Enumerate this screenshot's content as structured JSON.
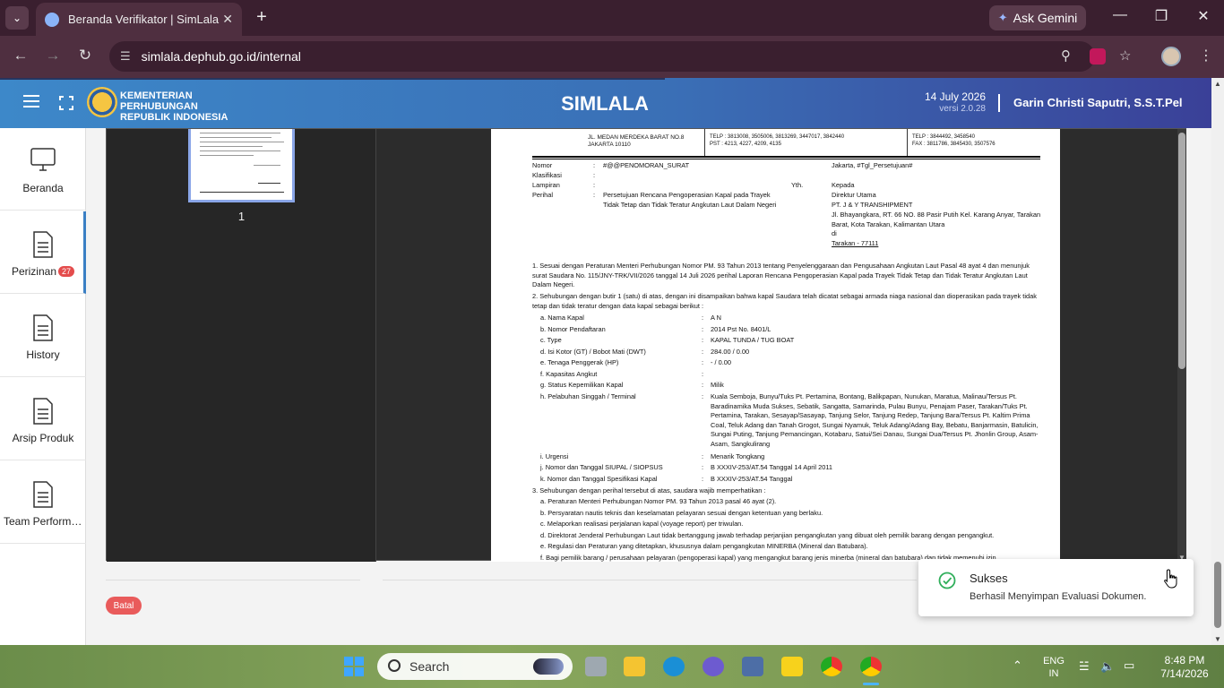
{
  "browser": {
    "tab_title": "Beranda Verifikator | SimLala",
    "url": "simlala.dephub.go.id/internal",
    "gemini_label": "Ask Gemini"
  },
  "header": {
    "ministry_line1": "KEMENTERIAN PERHUBUNGAN",
    "ministry_line2": "REPUBLIK INDONESIA",
    "app_title": "SIMLALA",
    "date": "14 July 2026",
    "version": "versi 2.0.28",
    "user": "Garin Christi Saputri, S.S.T.Pel"
  },
  "sidebar": {
    "items": [
      {
        "label": "Beranda",
        "icon": "monitor-icon"
      },
      {
        "label": "Perizinan",
        "icon": "document-icon",
        "badge": "27"
      },
      {
        "label": "History",
        "icon": "document-icon"
      },
      {
        "label": "Arsip Produk",
        "icon": "document-icon"
      },
      {
        "label": "Team Performance",
        "icon": "document-icon"
      }
    ]
  },
  "viewer": {
    "page_number": "1"
  },
  "letter": {
    "address_line1": "JL. MEDAN MERDEKA BARAT NO.8",
    "address_line2": "JAKARTA 10110",
    "telp1": "TELP :  3813008, 3505006, 3813269, 3447017, 3842440",
    "pst": "PST   :  4213, 4227, 4209, 4135",
    "telp2": "TELP :  3844492, 3458540",
    "fax": "FAX  :  3811786, 3845430, 3507576",
    "nomor_label": "Nomor",
    "nomor_value": "#@@PENOMORAN_SURAT",
    "klasifikasi_label": "Klasifikasi",
    "lampiran_label": "Lampiran",
    "perihal_label": "Perihal",
    "perihal_value": "Persetujuan Rencana Pengoperasian Kapal pada Trayek Tidak Tetap dan Tidak Teratur Angkutan Laut Dalam Negeri",
    "place_date": "Jakarta, #Tgl_Persetujuan#",
    "yth": "Yth.",
    "kepada": "Kepada",
    "recipient1": "Direktur Utama",
    "recipient2": "PT. J & Y TRANSHIPMENT",
    "recipient_addr": "Jl. Bhayangkara, RT. 66 NO. 88 Pasir Putih Kel. Karang Anyar, Tarakan Barat, Kota Tarakan, Kalimantan Utara",
    "di": "di",
    "city": "Tarakan  - 77111",
    "para1": "1. Sesuai dengan Peraturan Menteri Perhubungan Nomor PM. 93 Tahun 2013 tentang Penyelenggaraan dan Pengusahaan Angkutan Laut Pasal 48 ayat 4 dan menunjuk surat Saudara No. 115/JNY-TRK/VII/2026 tanggal 14 Juli 2026 perihal Laporan Rencana Pengoperasian Kapal pada Trayek Tidak Tetap dan Tidak Teratur Angkutan Laut Dalam Negeri.",
    "para2": "2. Sehubungan dengan butir 1 (satu) di atas, dengan ini disampaikan bahwa kapal Saudara telah dicatat sebagai armada niaga nasional dan dioperasikan pada trayek tidak tetap dan tidak teratur dengan data kapal sebagai berikut :",
    "ship_rows": [
      {
        "label": "a. Nama Kapal",
        "value": "A N"
      },
      {
        "label": "b. Nomor Pendaftaran",
        "value": "2014 Pst No. 8401/L"
      },
      {
        "label": "c. Type",
        "value": "KAPAL TUNDA / TUG BOAT"
      },
      {
        "label": "d. Isi Kotor (GT) / Bobot Mati (DWT)",
        "value": "284.00  / 0.00"
      },
      {
        "label": "e. Tenaga Penggerak (HP)",
        "value": "-  / 0.00"
      },
      {
        "label": "f.  Kapasitas Angkut",
        "value": ""
      },
      {
        "label": "g. Status Kepemilikan Kapal",
        "value": "Milik"
      },
      {
        "label": "h. Pelabuhan Singgah / Terminal",
        "value": "Kuala Semboja, Bunyu/Tuks Pt. Pertamina, Bontang, Balikpapan, Nunukan, Maratua, Malinau/Tersus Pt. Baradinamika Muda Sukses, Sebatik, Sangatta, Samarinda, Pulau Bunyu, Penajam Paser, Tarakan/Tuks Pt. Pertamina, Tarakan, Sesayap/Sasayap, Tanjung Selor, Tanjung Redep, Tanjung Bara/Tersus Pt. Kaltim Prima Coal, Teluk Adang dan Tanah Grogot, Sungai Nyamuk, Teluk Adang/Adang Bay, Bebatu, Banjarmasin, Batulicin, Sungai Puting, Tanjung Pemancingan, Kotabaru, Satui/Sei Danau, Sungai Dua/Tersus Pt. Jhonlin Group, Asam-Asam, Sangkulirang"
      },
      {
        "label": "i.  Urgensi",
        "value": "Menarik Tongkang"
      },
      {
        "label": "j.  Nomor dan Tanggal SIUPAL / SIOPSUS",
        "value": "B XXXIV-253/AT.54  Tanggal 14 April 2011"
      },
      {
        "label": "k.  Nomor dan Tanggal Spesifikasi Kapal",
        "value": "B XXXIV-253/AT.54  Tanggal"
      }
    ],
    "para3": "3. Sehubungan dengan perihal tersebut di atas, saudara wajib memperhatikan :",
    "obligations": [
      "a. Peraturan Menteri Perhubungan Nomor PM. 93 Tahun 2013 pasal 46 ayat (2).",
      "b. Persyaratan nautis teknis dan keselamatan pelayaran sesuai dengan ketentuan yang berlaku.",
      "c. Melaporkan realisasi perjalanan kapal (voyage report) per triwulan.",
      "d. Direktorat Jenderal Perhubungan Laut tidak bertanggung jawab terhadap perjanjian pengangkutan yang dibuat oleh pemilik barang dengan pengangkut.",
      "e. Regulasi dan Peraturan yang ditetapkan, khususnya dalam pengangkutan MINERBA (Mineral dan Batubara).",
      "f.  Bagi pemilik barang / perusahaan pelayaran (pengoperasi kapal) yang mengangkut barang jenis minerba (mineral dan batubara) dan tidak memenuhi izin"
    ]
  },
  "actions": {
    "cancel_label": "Batal"
  },
  "toast": {
    "title": "Sukses",
    "message": "Berhasil Menyimpan Evaluasi Dokumen."
  },
  "taskbar": {
    "search_placeholder": "Search",
    "lang_line1": "ENG",
    "lang_line2": "IN",
    "time": "8:48 PM",
    "date": "7/14/2026"
  }
}
